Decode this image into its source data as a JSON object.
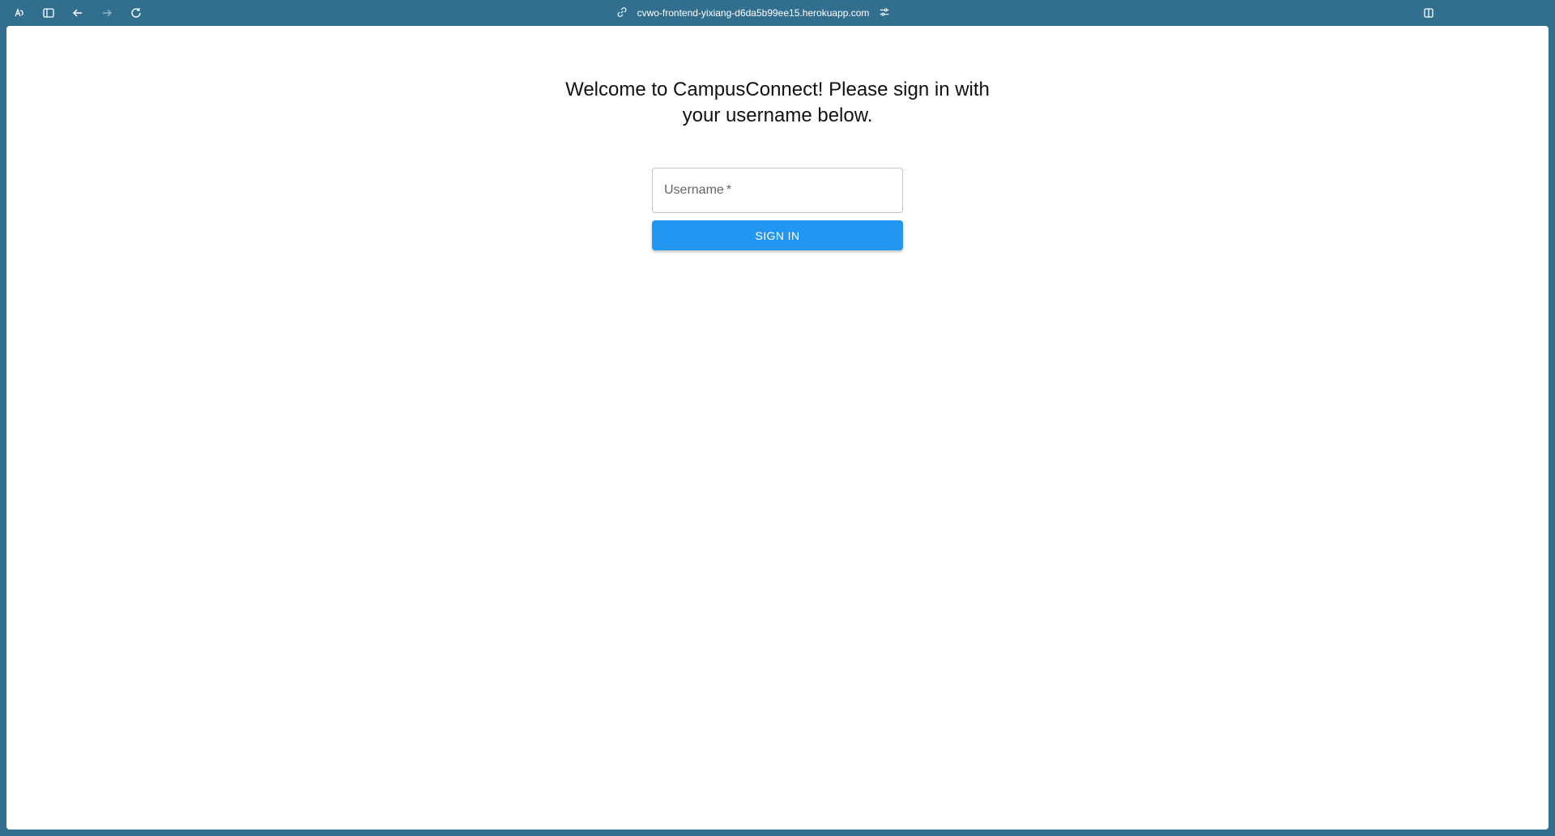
{
  "browser": {
    "url": "cvwo-frontend-yixiang-d6da5b99ee15.herokuapp.com",
    "icons": {
      "app_menu": "app-menu-icon",
      "sidebar": "sidebar-toggle-icon",
      "back": "back-arrow-icon",
      "forward": "forward-arrow-icon",
      "reload": "reload-icon",
      "site_info": "link-icon",
      "site_settings": "tune-icon",
      "split_view": "split-view-icon"
    }
  },
  "login": {
    "title": "Welcome to CampusConnect! Please sign in with your username below.",
    "username_label": "Username",
    "required_marker": "*",
    "username_value": "",
    "sign_in_label": "SIGN IN"
  },
  "colors": {
    "chrome_background": "#326f8f",
    "primary_button": "#2196f3",
    "page_background": "#ffffff"
  }
}
